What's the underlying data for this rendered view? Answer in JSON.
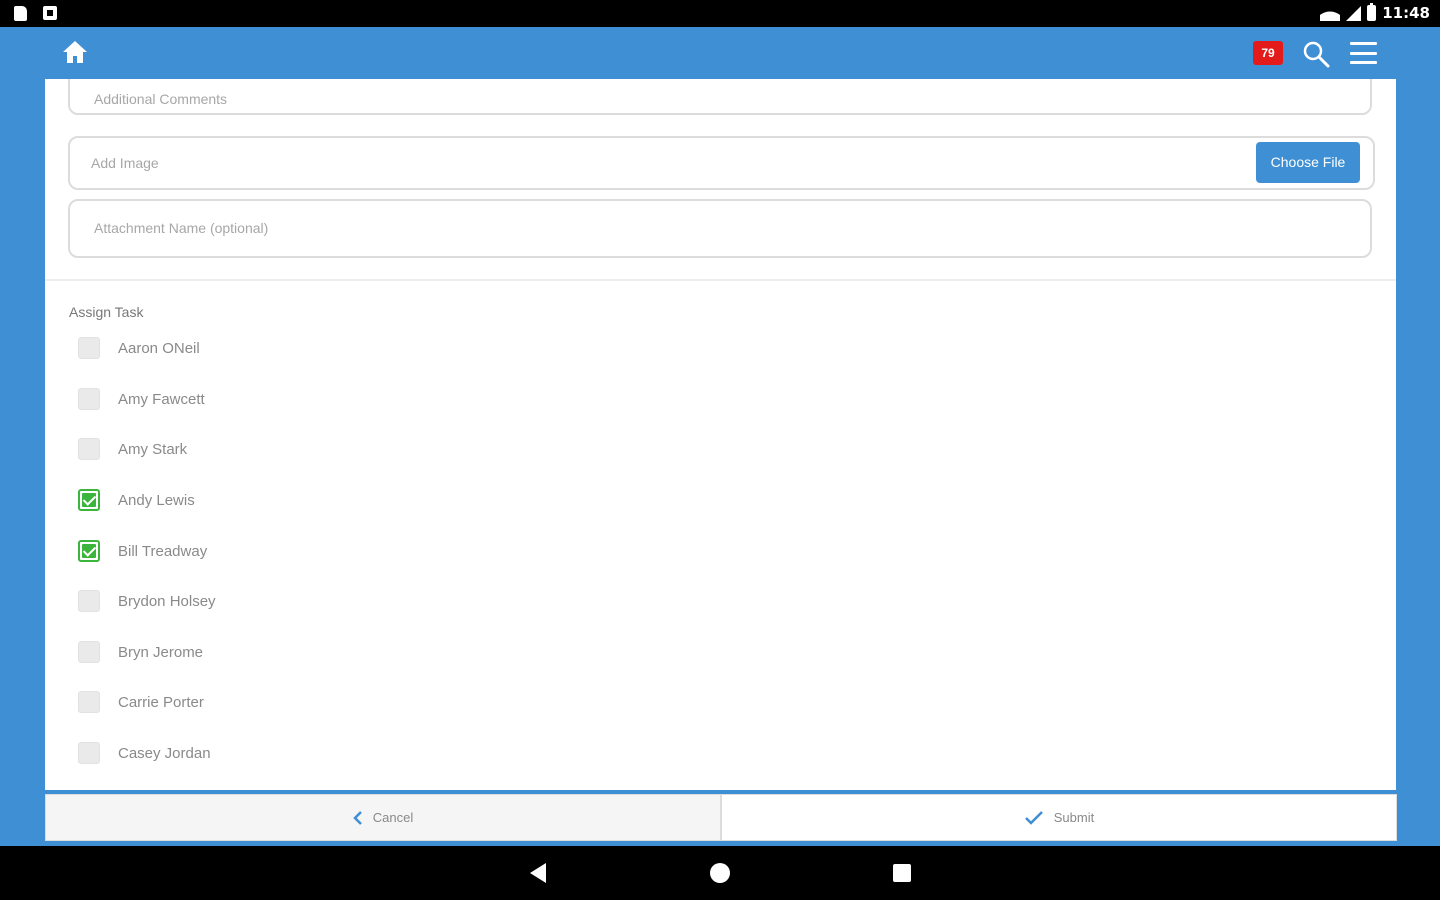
{
  "status_bar": {
    "time": "11:48"
  },
  "header": {
    "notification_count": "79"
  },
  "form": {
    "comments_placeholder": "Additional Comments",
    "image_placeholder": "Add Image",
    "choose_file_label": "Choose File",
    "attachment_placeholder": "Attachment Name (optional)",
    "assign_label": "Assign Task",
    "assignees": [
      {
        "name": "Aaron ONeil",
        "checked": false
      },
      {
        "name": "Amy Fawcett",
        "checked": false
      },
      {
        "name": "Amy Stark",
        "checked": false
      },
      {
        "name": "Andy Lewis",
        "checked": true
      },
      {
        "name": "Bill Treadway",
        "checked": true
      },
      {
        "name": "Brydon Holsey",
        "checked": false
      },
      {
        "name": "Bryn Jerome",
        "checked": false
      },
      {
        "name": "Carrie Porter",
        "checked": false
      },
      {
        "name": "Casey Jordan",
        "checked": false
      }
    ]
  },
  "footer": {
    "cancel_label": "Cancel",
    "submit_label": "Submit"
  },
  "colors": {
    "primary": "#3f8fd4",
    "badge": "#e41b1b",
    "check": "#3cb53c"
  }
}
